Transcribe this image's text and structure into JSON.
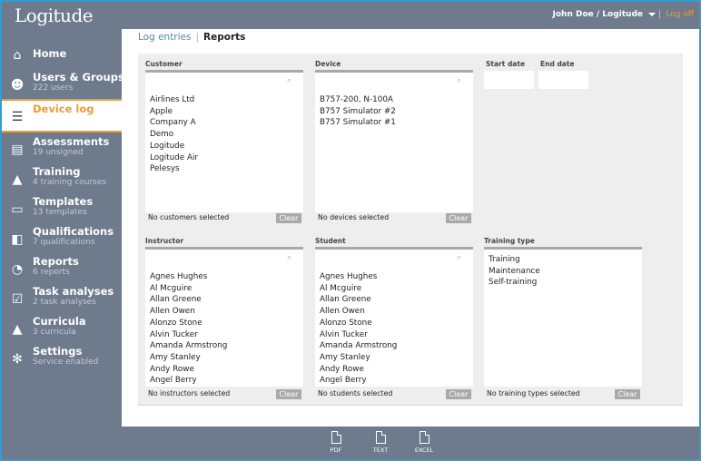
{
  "app": {
    "logo": "Logitude",
    "user": "John Doe / Logitude",
    "logoff": "Log off"
  },
  "sidebar": {
    "items": [
      {
        "label": "Home",
        "sub": "",
        "icon": "home-icon",
        "glyph": "⌂"
      },
      {
        "label": "Users & Groups",
        "sub": "222 users",
        "icon": "users-icon",
        "glyph": "☻"
      },
      {
        "label": "Device log",
        "sub": "",
        "icon": "list-icon",
        "glyph": "☰"
      },
      {
        "label": "Assessments",
        "sub": "19 unsigned",
        "icon": "clipboard-icon",
        "glyph": "▤"
      },
      {
        "label": "Training",
        "sub": "4 training courses",
        "icon": "graduation-cap-icon",
        "glyph": "▲"
      },
      {
        "label": "Templates",
        "sub": "13 templates",
        "icon": "folder-icon",
        "glyph": "▭"
      },
      {
        "label": "Qualifications",
        "sub": "7 qualifications",
        "icon": "certificate-icon",
        "glyph": "◧"
      },
      {
        "label": "Reports",
        "sub": "6 reports",
        "icon": "pie-chart-icon",
        "glyph": "◔"
      },
      {
        "label": "Task analyses",
        "sub": "2 task analyses",
        "icon": "checkbox-icon",
        "glyph": "☑"
      },
      {
        "label": "Curricula",
        "sub": "3 curricula",
        "icon": "mortarboard-icon",
        "glyph": "▲"
      },
      {
        "label": "Settings",
        "sub": "Service enabled",
        "icon": "gears-icon",
        "glyph": "✻"
      }
    ]
  },
  "breadcrumb": {
    "log_entries": "Log entries",
    "reports": "Reports"
  },
  "filters": {
    "customer": {
      "header": "Customer",
      "items": [
        "Airlines Ltd",
        "Apple",
        "Company A",
        "Demo",
        "Logitude",
        "Logitude Air",
        "Pelesys"
      ],
      "status": "No customers selected",
      "clear": "Clear"
    },
    "device": {
      "header": "Device",
      "items": [
        "B757-200, N-100A",
        "B757 Simulator #2",
        "B757 Simulator #1"
      ],
      "status": "No devices selected",
      "clear": "Clear"
    },
    "start_date": {
      "header": "Start date",
      "value": ""
    },
    "end_date": {
      "header": "End date",
      "value": ""
    },
    "instructor": {
      "header": "Instructor",
      "items": [
        "Agnes Hughes",
        "Al Mcguire",
        "Allan Greene",
        "Allen Owen",
        "Alonzo Stone",
        "Alvin Tucker",
        "Amanda Armstrong",
        "Amy Stanley",
        "Andy Rowe",
        "Angel Berry"
      ],
      "status": "No instructors selected",
      "clear": "Clear"
    },
    "student": {
      "header": "Student",
      "items": [
        "Agnes Hughes",
        "Al Mcguire",
        "Allan Greene",
        "Allen Owen",
        "Alonzo Stone",
        "Alvin Tucker",
        "Amanda Armstrong",
        "Amy Stanley",
        "Andy Rowe",
        "Angel Berry"
      ],
      "status": "No students selected",
      "clear": "Clear"
    },
    "training_type": {
      "header": "Training type",
      "items": [
        "Training",
        "Maintenance",
        "Self-training"
      ],
      "status": "No training types selected",
      "clear": "Clear"
    }
  },
  "export": {
    "pdf": "PDF",
    "text": "TEXT",
    "excel": "EXCEL"
  }
}
